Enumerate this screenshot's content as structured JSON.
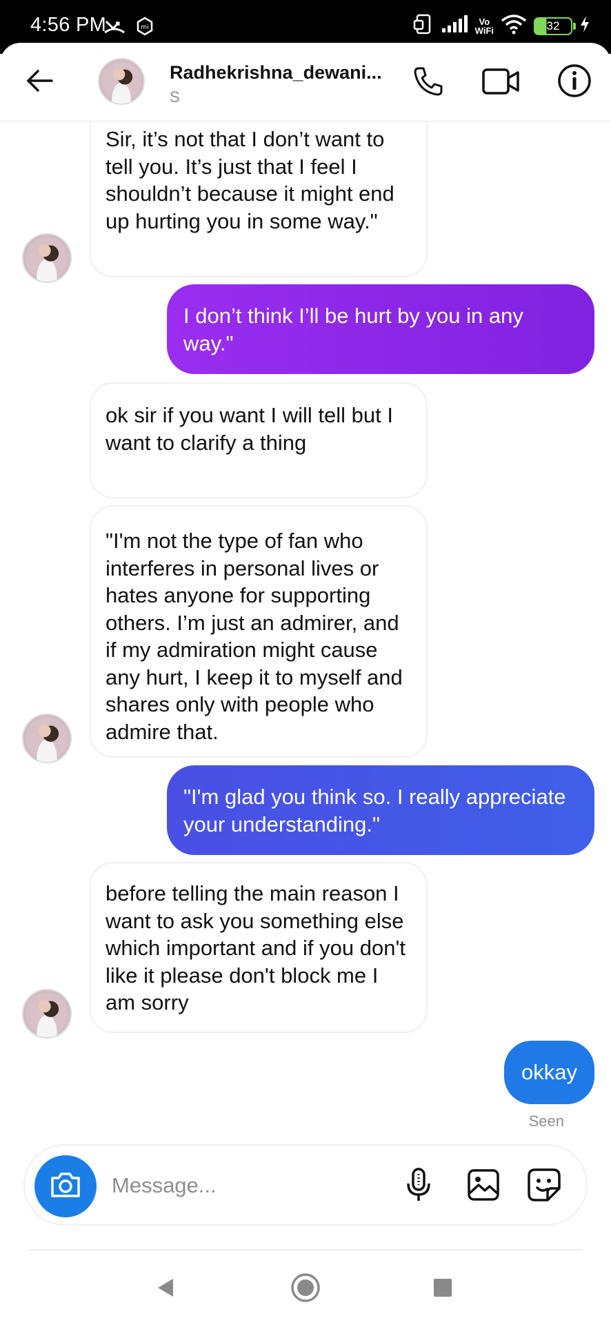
{
  "status_bar": {
    "time": "4:56 PM",
    "vowifi_top": "Vo",
    "vowifi_bottom": "WiFi",
    "battery": "32"
  },
  "header": {
    "contact_name": "Radhekrishna_dewani...",
    "contact_sub": "S",
    "icons": [
      "back-arrow-icon",
      "phone-icon",
      "video-camera-icon",
      "info-icon"
    ]
  },
  "messages": [
    {
      "direction": "incoming",
      "text": "Sir, it’s not that I don’t want to tell you. It’s just that I feel I shouldn’t because it might end up hurting you in some way.\""
    },
    {
      "direction": "outgoing",
      "text": "I don’t think I’ll be hurt by you in any way.\""
    },
    {
      "direction": "incoming",
      "text": "ok sir if you want I will tell but I want to clarify a thing"
    },
    {
      "direction": "incoming",
      "text": "\"I'm not the type of fan who interferes in personal lives or hates anyone for supporting others. I’m just an admirer, and if my admiration might cause any hurt, I keep it to myself and shares only with people who admire that."
    },
    {
      "direction": "outgoing",
      "text": "\"I'm glad you think so. I really appreciate your understanding.\""
    },
    {
      "direction": "incoming",
      "text": "before telling the main reason I want to ask you something else which important and if you don't like it please don't block me I am sorry"
    },
    {
      "direction": "outgoing",
      "text": "okkay"
    }
  ],
  "seen_label": "Seen",
  "composer": {
    "placeholder": "Message...",
    "icons": [
      "camera-icon",
      "microphone-icon",
      "gallery-icon",
      "sticker-icon"
    ]
  },
  "colors": {
    "outgoing_purple": "#8a2be2",
    "outgoing_indigo": "#4b55e6",
    "outgoing_blue": "#1f7ae8",
    "camera_button": "#1a7ee6"
  }
}
